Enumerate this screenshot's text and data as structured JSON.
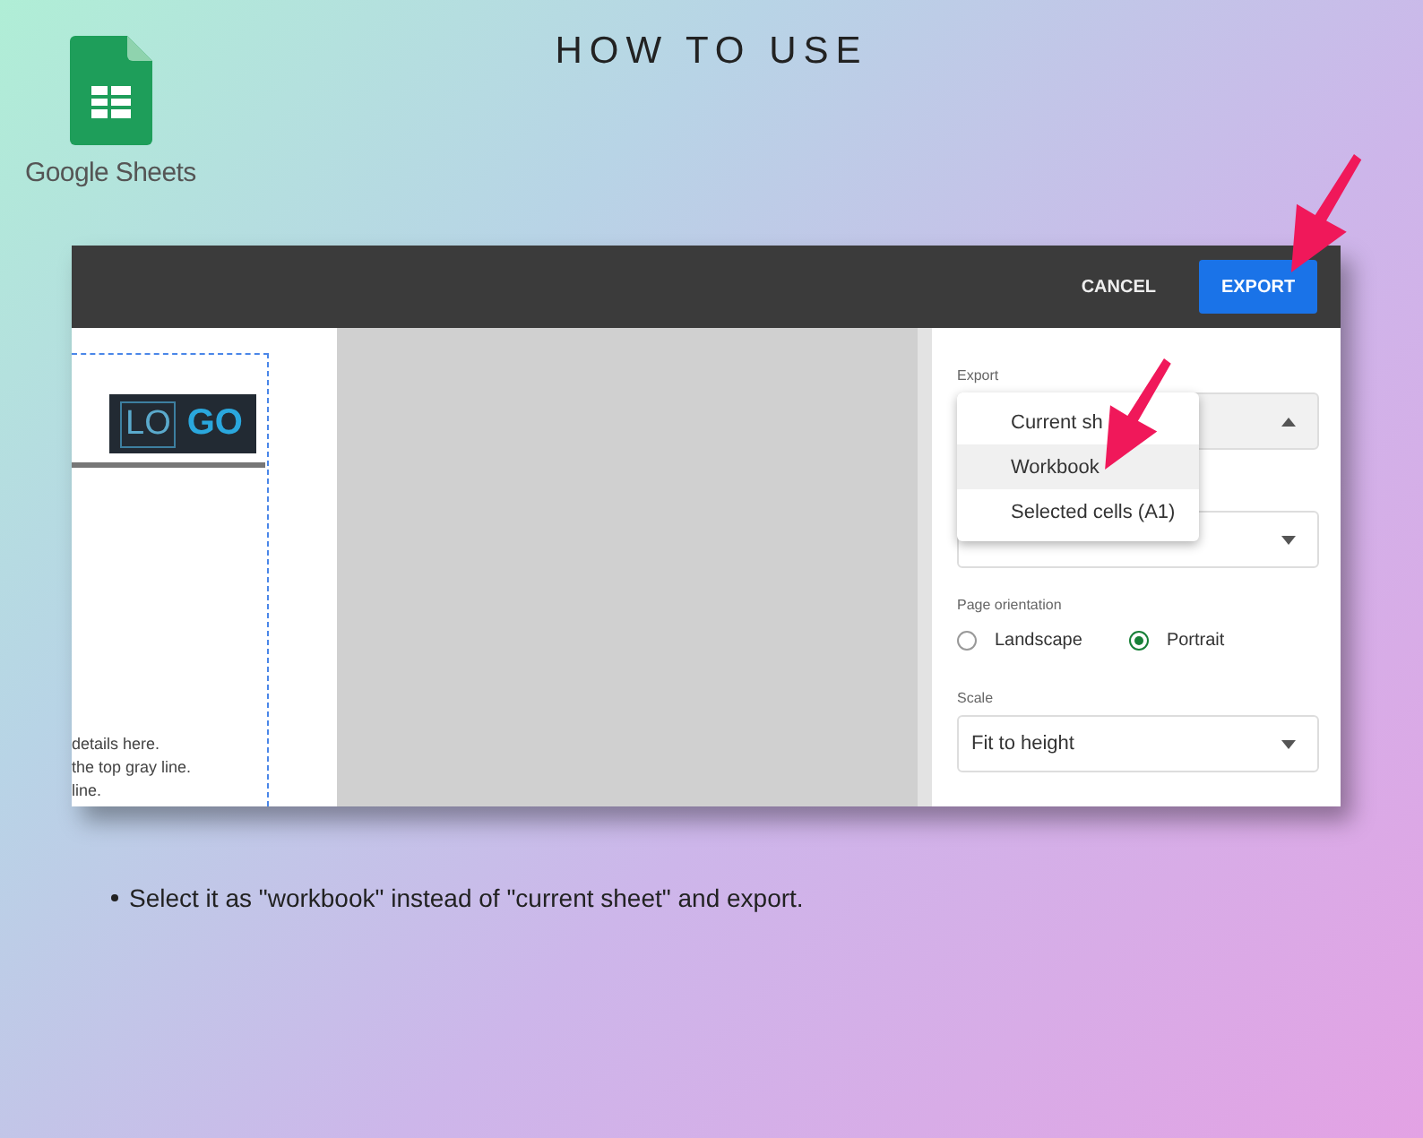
{
  "header": {
    "title": "HOW TO USE",
    "logo_label": "Google Sheets"
  },
  "dialog": {
    "buttons": [
      {
        "label": "CANCEL",
        "kind": "text"
      },
      {
        "label": "EXPORT",
        "kind": "primary"
      }
    ],
    "preview": {
      "logo": [
        "LO",
        "GO"
      ],
      "lines": [
        "details here.",
        "the top gray line.",
        "line."
      ]
    },
    "settings": {
      "export_label": "Export",
      "export_menu": {
        "expanded": true,
        "items": [
          {
            "label": "Current sh",
            "selected": false
          },
          {
            "label": "Workbook",
            "selected": true
          },
          {
            "label": "Selected cells (A1)",
            "selected": false
          }
        ]
      },
      "orientation_label": "Page orientation",
      "orientation": [
        {
          "label": "Landscape",
          "selected": false
        },
        {
          "label": "Portrait",
          "selected": true
        }
      ],
      "scale_label": "Scale",
      "scale_value": "Fit to height"
    }
  },
  "instructions": [
    "Select it as \"workbook\" instead of \"current sheet\" and export."
  ]
}
